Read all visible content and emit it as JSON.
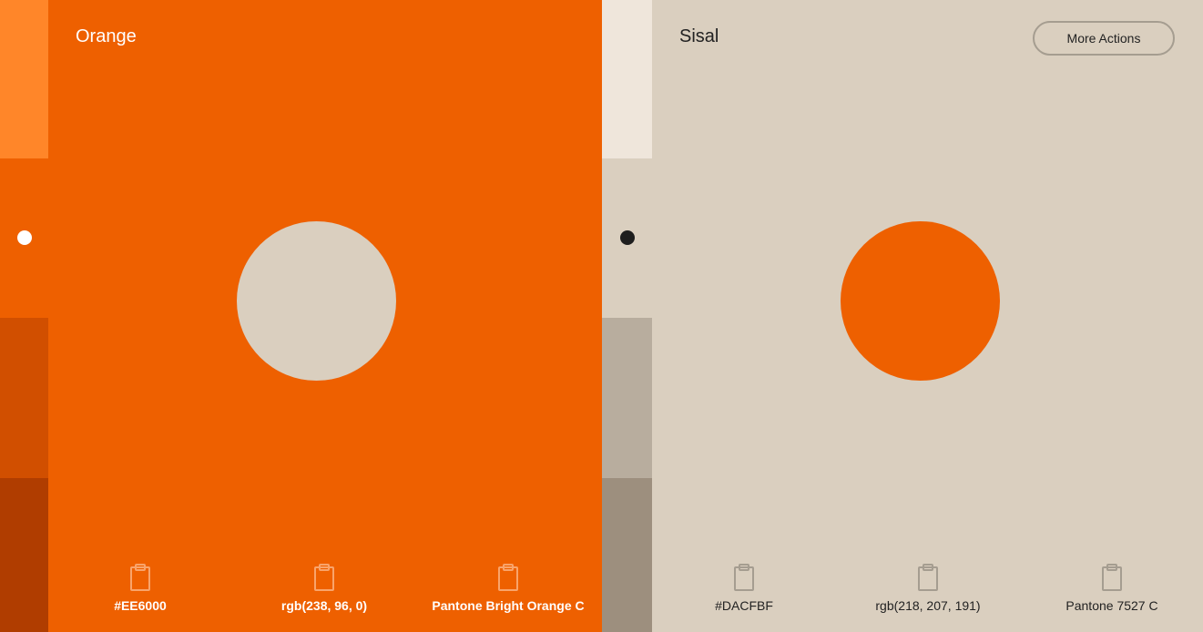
{
  "colors": {
    "left_strip": [
      "#FF8629",
      "#EE6000",
      "#D14F00",
      "#B03D00"
    ],
    "right_strip": [
      "#EFE6DB",
      "#DACFBF",
      "#B8AD9E",
      "#9D8F7E"
    ],
    "orange": "#EE6000",
    "sisal": "#DACFBF"
  },
  "left_panel": {
    "title": "Orange",
    "title_color": "#FFFFFF",
    "circle_color": "#DACFBF",
    "icon_color": "#F9A46B",
    "codes": [
      {
        "label": "#EE6000",
        "icon": "clipboard-icon"
      },
      {
        "label": "rgb(238, 96, 0)",
        "icon": "clipboard-icon"
      },
      {
        "label": "Pantone Bright Orange C",
        "icon": "clipboard-icon"
      }
    ]
  },
  "right_panel": {
    "title": "Sisal",
    "title_color": "#222222",
    "circle_color": "#EE6000",
    "icon_color": "#A59D90",
    "more_actions_label": "More Actions",
    "codes": [
      {
        "label": "#DACFBF",
        "icon": "clipboard-icon"
      },
      {
        "label": "rgb(218, 207, 191)",
        "icon": "clipboard-icon"
      },
      {
        "label": "Pantone 7527 C",
        "icon": "clipboard-icon"
      }
    ]
  },
  "selected_indicator": {
    "left_dot_color": "#FFFFFF",
    "right_dot_color": "#1E1E1E"
  }
}
